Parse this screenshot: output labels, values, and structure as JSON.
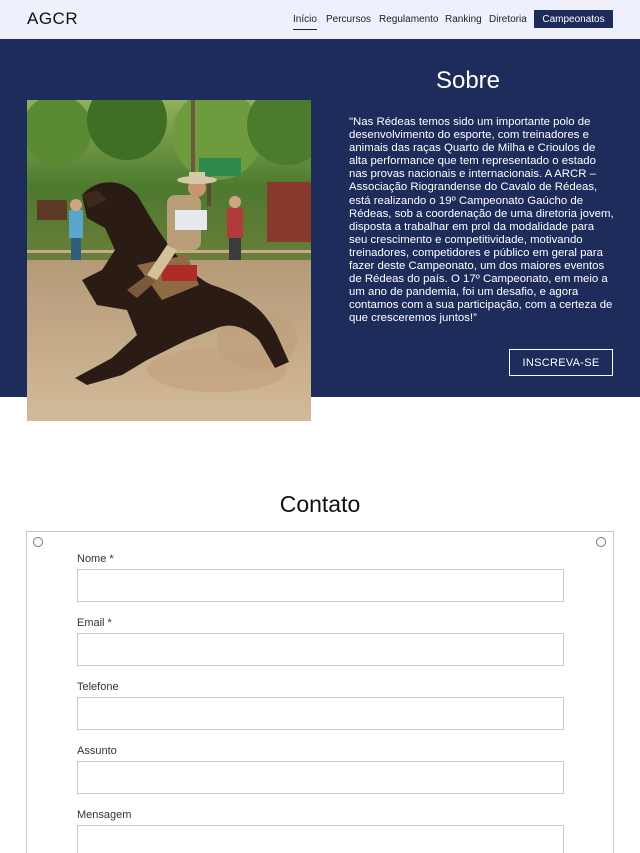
{
  "header": {
    "logo": "AGCR",
    "nav": [
      "Início",
      "Percursos",
      "Regulamento",
      "Ranking",
      "Diretoria"
    ],
    "cta_label": "Campeonatos"
  },
  "about": {
    "title": "Sobre",
    "text": "\"Nas Rédeas temos sido um importante polo de desenvolvimento do esporte, com treinadores e animais das raças Quarto de Milha e Crioulos de alta performance que tem representado o estado nas provas nacionais e internacionais. A ARCR – Associação Riograndense do Cavalo de Rédeas, está realizando o 19º Campeonato Gaúcho de Rédeas, sob a coordenação de uma diretoria jovem, disposta a trabalhar em prol da modalidade para seu crescimento e competitividade, motivando treinadores, competidores e público em geral para fazer deste Campeonato, um dos maiores eventos de Rédeas do país. O 17º Campeonato, em meio a um ano de pandemia, foi um desafio, e agora contamos com a sua participação, com a certeza de que cresceremos juntos!”",
    "button_label": "INSCREVA-SE",
    "photo_alt": "Rider on a horse performing a sliding stop in an arena"
  },
  "contact": {
    "title": "Contato",
    "fields": {
      "nome": "Nome *",
      "email": "Email *",
      "telefone": "Telefone",
      "assunto": "Assunto",
      "mensagem": "Mensagem"
    }
  },
  "colors": {
    "navy": "#1e2c5c",
    "header_bg": "#eef1fb"
  }
}
